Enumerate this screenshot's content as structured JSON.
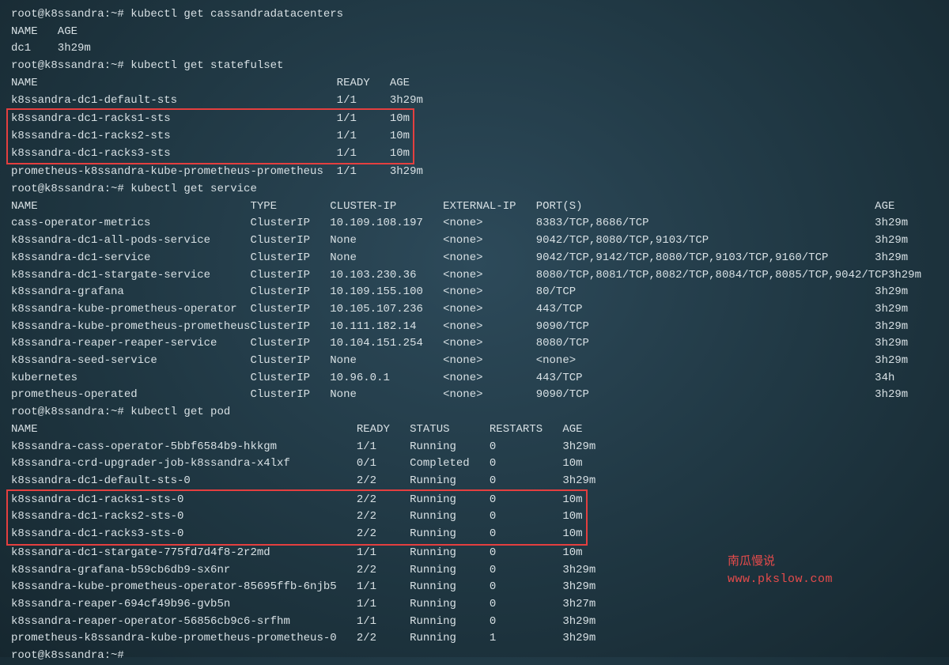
{
  "prompt": "root@k8ssandra:~#",
  "cmd1": "kubectl get cassandradatacenters",
  "dc_header": {
    "name": "NAME",
    "age": "AGE"
  },
  "dc_rows": [
    {
      "name": "dc1",
      "age": "3h29m"
    }
  ],
  "cmd2": "kubectl get statefulset",
  "sts_header": {
    "name": "NAME",
    "ready": "READY",
    "age": "AGE"
  },
  "sts_rows": [
    {
      "name": "k8ssandra-dc1-default-sts",
      "ready": "1/1",
      "age": "3h29m",
      "hl": false
    },
    {
      "name": "k8ssandra-dc1-racks1-sts",
      "ready": "1/1",
      "age": "10m",
      "hl": true
    },
    {
      "name": "k8ssandra-dc1-racks2-sts",
      "ready": "1/1",
      "age": "10m",
      "hl": true
    },
    {
      "name": "k8ssandra-dc1-racks3-sts",
      "ready": "1/1",
      "age": "10m",
      "hl": true
    },
    {
      "name": "prometheus-k8ssandra-kube-prometheus-prometheus",
      "ready": "1/1",
      "age": "3h29m",
      "hl": false
    }
  ],
  "cmd3": "kubectl get service",
  "svc_header": {
    "name": "NAME",
    "type": "TYPE",
    "cluster_ip": "CLUSTER-IP",
    "external_ip": "EXTERNAL-IP",
    "ports": "PORT(S)",
    "age": "AGE"
  },
  "svc_rows": [
    {
      "name": "cass-operator-metrics",
      "type": "ClusterIP",
      "cluster_ip": "10.109.108.197",
      "external_ip": "<none>",
      "ports": "8383/TCP,8686/TCP",
      "age": "3h29m"
    },
    {
      "name": "k8ssandra-dc1-all-pods-service",
      "type": "ClusterIP",
      "cluster_ip": "None",
      "external_ip": "<none>",
      "ports": "9042/TCP,8080/TCP,9103/TCP",
      "age": "3h29m"
    },
    {
      "name": "k8ssandra-dc1-service",
      "type": "ClusterIP",
      "cluster_ip": "None",
      "external_ip": "<none>",
      "ports": "9042/TCP,9142/TCP,8080/TCP,9103/TCP,9160/TCP",
      "age": "3h29m"
    },
    {
      "name": "k8ssandra-dc1-stargate-service",
      "type": "ClusterIP",
      "cluster_ip": "10.103.230.36",
      "external_ip": "<none>",
      "ports": "8080/TCP,8081/TCP,8082/TCP,8084/TCP,8085/TCP,9042/TCP",
      "age": "3h29m"
    },
    {
      "name": "k8ssandra-grafana",
      "type": "ClusterIP",
      "cluster_ip": "10.109.155.100",
      "external_ip": "<none>",
      "ports": "80/TCP",
      "age": "3h29m"
    },
    {
      "name": "k8ssandra-kube-prometheus-operator",
      "type": "ClusterIP",
      "cluster_ip": "10.105.107.236",
      "external_ip": "<none>",
      "ports": "443/TCP",
      "age": "3h29m"
    },
    {
      "name": "k8ssandra-kube-prometheus-prometheus",
      "type": "ClusterIP",
      "cluster_ip": "10.111.182.14",
      "external_ip": "<none>",
      "ports": "9090/TCP",
      "age": "3h29m"
    },
    {
      "name": "k8ssandra-reaper-reaper-service",
      "type": "ClusterIP",
      "cluster_ip": "10.104.151.254",
      "external_ip": "<none>",
      "ports": "8080/TCP",
      "age": "3h29m"
    },
    {
      "name": "k8ssandra-seed-service",
      "type": "ClusterIP",
      "cluster_ip": "None",
      "external_ip": "<none>",
      "ports": "<none>",
      "age": "3h29m"
    },
    {
      "name": "kubernetes",
      "type": "ClusterIP",
      "cluster_ip": "10.96.0.1",
      "external_ip": "<none>",
      "ports": "443/TCP",
      "age": "34h"
    },
    {
      "name": "prometheus-operated",
      "type": "ClusterIP",
      "cluster_ip": "None",
      "external_ip": "<none>",
      "ports": "9090/TCP",
      "age": "3h29m"
    }
  ],
  "cmd4": "kubectl get pod",
  "pod_header": {
    "name": "NAME",
    "ready": "READY",
    "status": "STATUS",
    "restarts": "RESTARTS",
    "age": "AGE"
  },
  "pod_rows": [
    {
      "name": "k8ssandra-cass-operator-5bbf6584b9-hkkgm",
      "ready": "1/1",
      "status": "Running",
      "restarts": "0",
      "age": "3h29m",
      "hl": false
    },
    {
      "name": "k8ssandra-crd-upgrader-job-k8ssandra-x4lxf",
      "ready": "0/1",
      "status": "Completed",
      "restarts": "0",
      "age": "10m",
      "hl": false
    },
    {
      "name": "k8ssandra-dc1-default-sts-0",
      "ready": "2/2",
      "status": "Running",
      "restarts": "0",
      "age": "3h29m",
      "hl": false
    },
    {
      "name": "k8ssandra-dc1-racks1-sts-0",
      "ready": "2/2",
      "status": "Running",
      "restarts": "0",
      "age": "10m",
      "hl": true
    },
    {
      "name": "k8ssandra-dc1-racks2-sts-0",
      "ready": "2/2",
      "status": "Running",
      "restarts": "0",
      "age": "10m",
      "hl": true
    },
    {
      "name": "k8ssandra-dc1-racks3-sts-0",
      "ready": "2/2",
      "status": "Running",
      "restarts": "0",
      "age": "10m",
      "hl": true
    },
    {
      "name": "k8ssandra-dc1-stargate-775fd7d4f8-2r2md",
      "ready": "1/1",
      "status": "Running",
      "restarts": "0",
      "age": "10m",
      "hl": false
    },
    {
      "name": "k8ssandra-grafana-b59cb6db9-sx6nr",
      "ready": "2/2",
      "status": "Running",
      "restarts": "0",
      "age": "3h29m",
      "hl": false
    },
    {
      "name": "k8ssandra-kube-prometheus-operator-85695ffb-6njb5",
      "ready": "1/1",
      "status": "Running",
      "restarts": "0",
      "age": "3h29m",
      "hl": false
    },
    {
      "name": "k8ssandra-reaper-694cf49b96-gvb5n",
      "ready": "1/1",
      "status": "Running",
      "restarts": "0",
      "age": "3h27m",
      "hl": false
    },
    {
      "name": "k8ssandra-reaper-operator-56856cb9c6-srfhm",
      "ready": "1/1",
      "status": "Running",
      "restarts": "0",
      "age": "3h29m",
      "hl": false
    },
    {
      "name": "prometheus-k8ssandra-kube-prometheus-prometheus-0",
      "ready": "2/2",
      "status": "Running",
      "restarts": "1",
      "age": "3h29m",
      "hl": false
    }
  ],
  "watermark1": "南瓜慢说",
  "watermark2": "www.pkslow.com"
}
